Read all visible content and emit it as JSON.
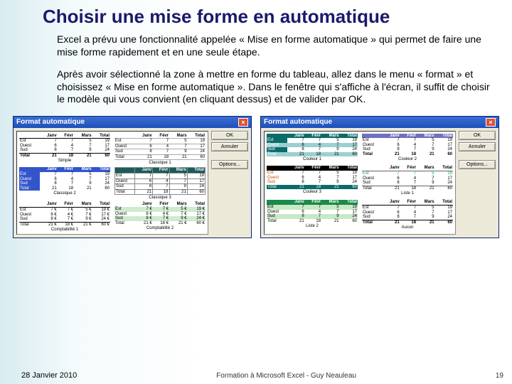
{
  "title": "Choisir une mise forme en automatique",
  "para1": "Excel a prévu une fonctionnalité appelée « Mise en forme automatique » qui permet de faire une mise forme rapidement et en une seule étape.",
  "para2": "Après avoir sélectionné la zone à mettre en forme du tableau, allez dans le menu « format » et choisissez « Mise en forme automatique ». Dans le fenêtre qui s'affiche à l'écran, il suffit de choisir le modèle qui vous convient (en cliquant dessus) et de valider par OK.",
  "dialog": {
    "title": "Format automatique",
    "buttons": {
      "ok": "OK",
      "cancel": "Annuler",
      "options": "Options..."
    }
  },
  "samples": {
    "headers": [
      "",
      "Janv",
      "Févr",
      "Mars",
      "Total"
    ],
    "rows": [
      [
        "Est",
        "7",
        "7",
        "5",
        "19"
      ],
      [
        "Ouest",
        "6",
        "4",
        "7",
        "17"
      ],
      [
        "Sud",
        "8",
        "7",
        "9",
        "24"
      ],
      [
        "Total",
        "21",
        "18",
        "21",
        "60"
      ]
    ],
    "comp_headers": [
      "",
      "Janv",
      "Févr",
      "Mars",
      "Total"
    ],
    "comp_rows": [
      [
        "Est",
        "7 €",
        "7 €",
        "5 €",
        "19 €"
      ],
      [
        "Ouest",
        "6 €",
        "4 €",
        "7 €",
        "17 €"
      ],
      [
        "Sud",
        "8 €",
        "7 €",
        "9 €",
        "24 €"
      ],
      [
        "Total",
        "21 €",
        "18 €",
        "21 €",
        "60 €"
      ]
    ],
    "labels": {
      "simple": "Simple",
      "classic1": "Classique 1",
      "classic2": "Classique 2",
      "classic3": "Classique 3",
      "comp1": "Comptabilité 1",
      "comp2": "Comptabilité 2",
      "color1": "Couleur 1",
      "color2": "Couleur 2",
      "color3": "Couleur 3",
      "list1": "Liste 1",
      "list2": "Liste 2",
      "none": "Aucun"
    }
  },
  "footer": {
    "date": "28 Janvier 2010",
    "center": "Formation à Microsoft Excel - Guy Neauleau",
    "page": "19"
  }
}
